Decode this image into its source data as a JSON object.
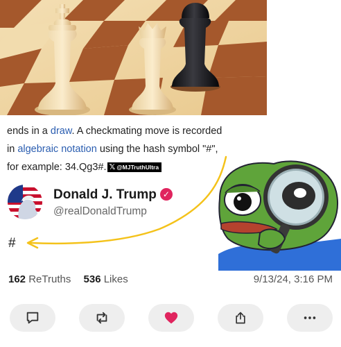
{
  "caption": {
    "line1_pre": "ends in a ",
    "draw_link": "draw",
    "line1_post": ". A checkmating move is recorded",
    "line2_pre": "in ",
    "notation_link": "algebraic notation",
    "line2_post": " using the hash symbol \"#\",",
    "line3": "for example: 34.Qg3#.",
    "watermark": "@MJTruthUltra"
  },
  "post": {
    "display_name": "Donald J. Trump",
    "handle": "@realDonaldTrump",
    "body": "#",
    "retruths_count": "162",
    "retruths_label": "ReTruths",
    "likes_count": "536",
    "likes_label": "Likes",
    "timestamp": "9/13/24, 3:16 PM"
  },
  "icons": {
    "reply": "comment-icon",
    "retruth": "repost-icon",
    "like": "heart-icon",
    "share": "share-icon",
    "more": "more-icon"
  },
  "colors": {
    "like_heart": "#e0245e",
    "verified_badge": "#e0245e",
    "link": "#2a5db0",
    "arrow": "#f4c21a",
    "action_bg": "#eeeeee"
  }
}
